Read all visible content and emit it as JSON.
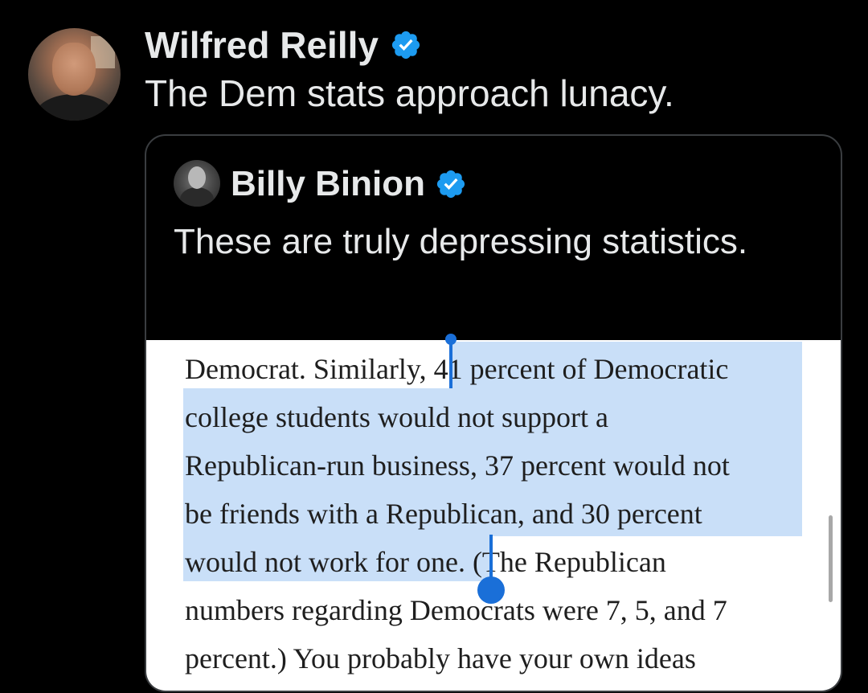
{
  "tweet": {
    "author": "Wilfred Reilly",
    "text": "The Dem stats approach lunacy."
  },
  "quoted_tweet": {
    "author": "Billy Binion",
    "text": "These are truly depressing statistics."
  },
  "book_excerpt": {
    "lines": [
      "Democrat. Similarly, 41 percent of Democratic",
      "college students would not support a",
      "Republican-run business, 37 percent would not",
      "be friends with a Republican, and 30 percent",
      "would not work for one. (The Republican",
      "numbers regarding Democrats were 7, 5, and 7",
      "percent.) You probably have your own ideas"
    ]
  },
  "icons": {
    "verified": "verified-badge-icon"
  },
  "colors": {
    "background": "#000000",
    "text": "#e7e9ea",
    "verified_blue": "#1d9bf0",
    "highlight": "#c9dff8",
    "selection_handle": "#1a6fd8"
  }
}
